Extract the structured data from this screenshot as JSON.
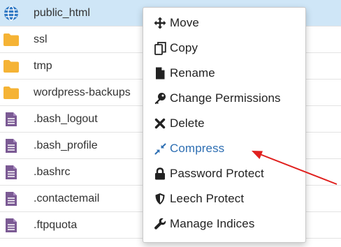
{
  "files": [
    {
      "name": "public_html",
      "icon": "globe-icon",
      "selected": true
    },
    {
      "name": "ssl",
      "icon": "folder-icon",
      "selected": false
    },
    {
      "name": "tmp",
      "icon": "folder-icon",
      "selected": false
    },
    {
      "name": "wordpress-backups",
      "icon": "folder-icon",
      "selected": false
    },
    {
      "name": ".bash_logout",
      "icon": "text-file-icon",
      "selected": false
    },
    {
      "name": ".bash_profile",
      "icon": "text-file-icon",
      "selected": false
    },
    {
      "name": ".bashrc",
      "icon": "text-file-icon",
      "selected": false
    },
    {
      "name": ".contactemail",
      "icon": "text-file-icon",
      "selected": false
    },
    {
      "name": ".ftpquota",
      "icon": "text-file-icon",
      "selected": false
    }
  ],
  "menu": [
    {
      "label": "Move",
      "icon": "move-icon"
    },
    {
      "label": "Copy",
      "icon": "copy-icon"
    },
    {
      "label": "Rename",
      "icon": "rename-file-icon"
    },
    {
      "label": "Change Permissions",
      "icon": "key-icon"
    },
    {
      "label": "Delete",
      "icon": "delete-x-icon"
    },
    {
      "label": "Compress",
      "icon": "compress-icon",
      "highlighted": true
    },
    {
      "label": "Password Protect",
      "icon": "lock-icon"
    },
    {
      "label": "Leech Protect",
      "icon": "shield-icon"
    },
    {
      "label": "Manage Indices",
      "icon": "wrench-icon"
    }
  ],
  "colors": {
    "selected_row": "#cfe6f7",
    "folder": "#f5b335",
    "text_file": "#7b5a94",
    "globe": "#2f79c4",
    "highlight_text": "#2e6fb3",
    "annotation_arrow": "#e0201e"
  }
}
